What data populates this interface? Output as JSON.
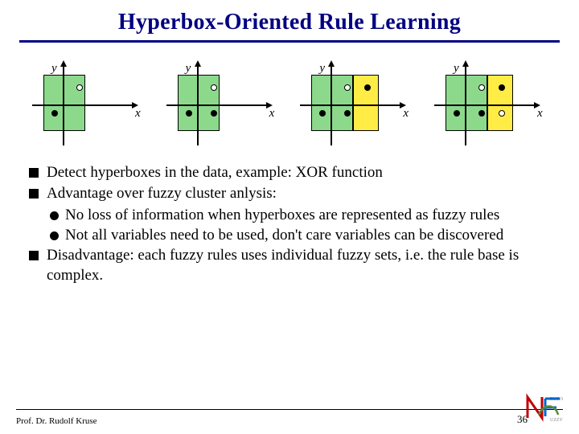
{
  "title": "Hyperbox-Oriented Rule Learning",
  "axis": {
    "x": "x",
    "y": "y"
  },
  "bullets": {
    "b1": "Detect hyperboxes in the data, example: XOR function",
    "b2": "Advantage over fuzzy cluster anlysis:",
    "b2a": "No loss of information when hyperboxes are represented as fuzzy rules",
    "b2b": "Not all variables need to be used, don't care variables can be discovered",
    "b3": "Disadvantage: each fuzzy rules uses individual fuzzy sets, i.e. the rule base is complex."
  },
  "footer": {
    "author": "Prof. Dr. Rudolf Kruse",
    "page": "36",
    "logo_top": "EURO",
    "logo_bot": "UZZY"
  }
}
